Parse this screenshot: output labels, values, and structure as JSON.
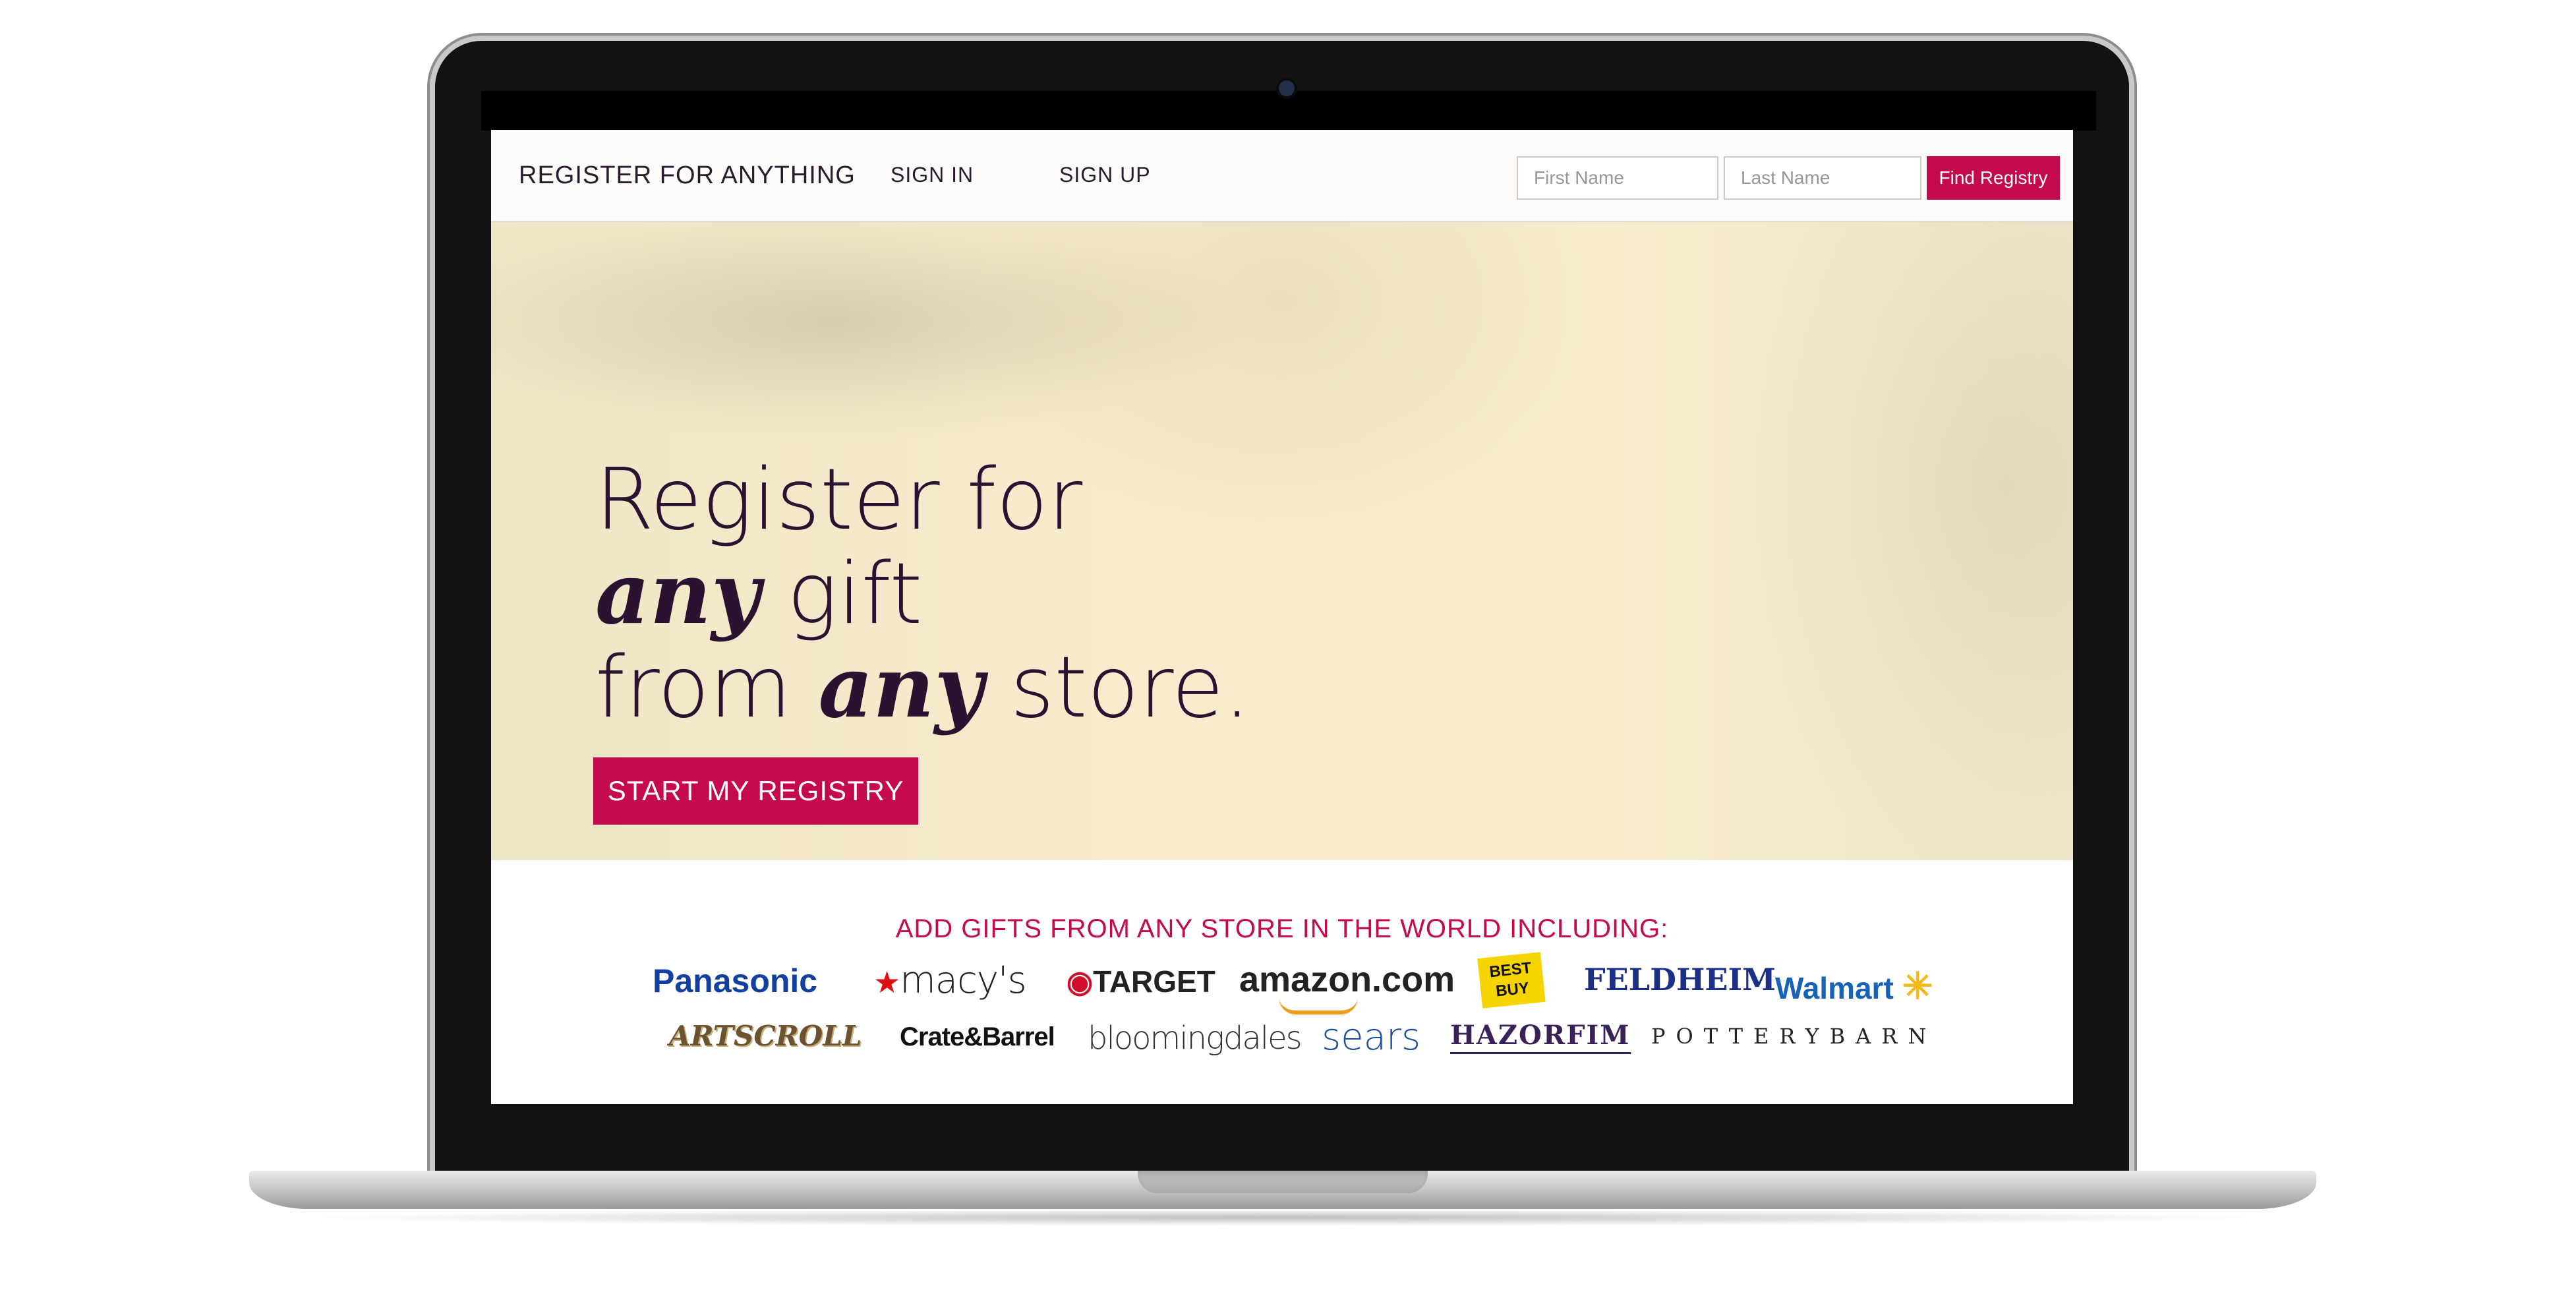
{
  "header": {
    "brand": "REGISTER FOR ANYTHING",
    "nav": {
      "sign_in": "SIGN IN",
      "sign_up": "SIGN UP"
    },
    "search": {
      "first_name_placeholder": "First Name",
      "last_name_placeholder": "Last Name",
      "button_label": "Find Registry"
    }
  },
  "hero": {
    "line1": "Register for",
    "line2_emphasis": "any",
    "line2_rest": " gift",
    "line3_start": "from ",
    "line3_emphasis": "any",
    "line3_end": " store.",
    "cta_label": "START MY REGISTRY"
  },
  "stores": {
    "heading": "ADD GIFTS FROM ANY STORE IN THE WORLD INCLUDING:",
    "logos": {
      "panasonic": "Panasonic",
      "macys_star": "★",
      "macys": "macy's",
      "target_icon": "◉",
      "target": "TARGET",
      "amazon": "amazon.com",
      "bestbuy_line1": "BEST",
      "bestbuy_line2": "BUY",
      "feldheim": "FELDHEIM",
      "walmart": "Walmart",
      "walmart_spark": "✳",
      "artscroll": "ARTSCROLL",
      "crate": "Crate&Barrel",
      "bloomingdales": "bloomingdales",
      "sears": "sears",
      "hazorfim": "HAZORFIM",
      "pottery_barn": "POTTERYBARN"
    }
  },
  "colors": {
    "accent": "#c4094f",
    "hero_text": "#2a1230",
    "hero_background": "#f7eccd"
  }
}
